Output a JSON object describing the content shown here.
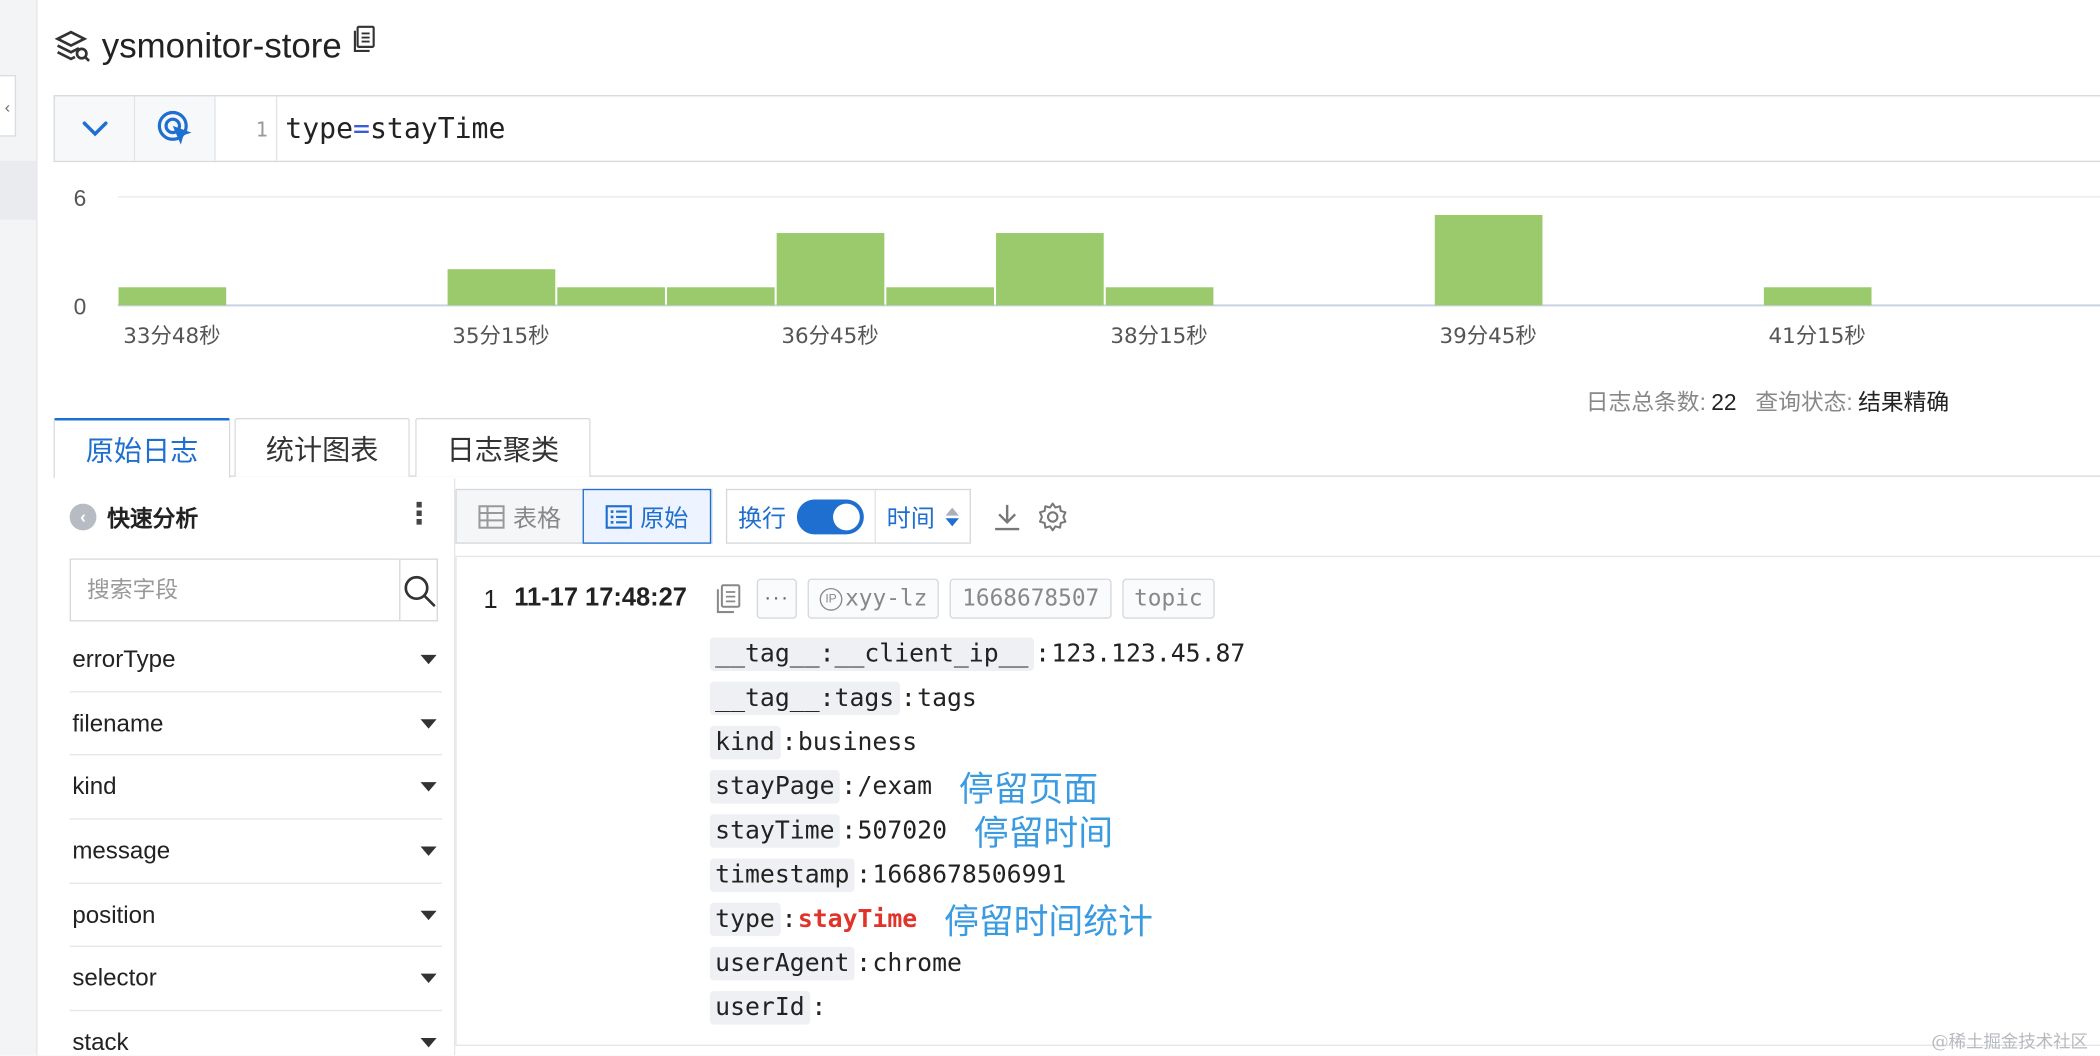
{
  "header": {
    "title": "ysmonitor-store"
  },
  "query": {
    "line_number": "1",
    "key": "type",
    "operator": "=",
    "value": "stayTime"
  },
  "chart_data": {
    "type": "bar",
    "y_ticks": [
      "6",
      "0"
    ],
    "ylim": [
      0,
      6
    ],
    "x_tick_labels": [
      "33分48秒",
      "35分15秒",
      "36分45秒",
      "38分15秒",
      "39分45秒",
      "41分15秒"
    ],
    "values": [
      1,
      0,
      0,
      2,
      1,
      1,
      4,
      1,
      4,
      1,
      0,
      0,
      5,
      0,
      0,
      1,
      0,
      0,
      0,
      0,
      0,
      0,
      0,
      0,
      0,
      0,
      0,
      0,
      0
    ],
    "bar_color": "#9aca6c",
    "grid": true
  },
  "summary": {
    "total_label": "日志总条数:",
    "total_value": "22",
    "status_label": "查询状态:",
    "status_value": "结果精确"
  },
  "tabs": [
    {
      "label": "原始日志",
      "active": true
    },
    {
      "label": "统计图表",
      "active": false
    },
    {
      "label": "日志聚类",
      "active": false
    }
  ],
  "quick_analysis": {
    "title": "快速分析",
    "collapse_icon": "chevron-left-icon",
    "more_icon": "vertical-ellipsis-icon",
    "search_placeholder": "搜索字段",
    "fields": [
      "errorType",
      "filename",
      "kind",
      "message",
      "position",
      "selector",
      "stack"
    ]
  },
  "toolbar": {
    "table_label": "表格",
    "raw_label": "原始",
    "wrap_label": "换行",
    "wrap_on": true,
    "time_label": "时间"
  },
  "log": {
    "index": "1",
    "time": "11-17 17:48:27",
    "source": "xyy-lz",
    "source_badge": "IP",
    "time_chip": "1668678507",
    "topic_chip": "topic",
    "fields": [
      {
        "key": "__tag__:__client_ip__",
        "value": "123.123.45.87",
        "note": ""
      },
      {
        "key": "__tag__:tags",
        "value": "tags",
        "note": ""
      },
      {
        "key": "kind",
        "value": "business",
        "note": ""
      },
      {
        "key": "stayPage",
        "value": "/exam",
        "note": "停留页面"
      },
      {
        "key": "stayTime",
        "value": "507020",
        "note": "停留时间"
      },
      {
        "key": "timestamp",
        "value": "1668678506991",
        "note": ""
      },
      {
        "key": "type",
        "value": "stayTime",
        "note": "停留时间统计",
        "highlight": true
      },
      {
        "key": "userAgent",
        "value": "chrome",
        "note": ""
      },
      {
        "key": "userId",
        "value": "",
        "note": ""
      }
    ]
  },
  "watermark": "@稀土掘金技术社区"
}
